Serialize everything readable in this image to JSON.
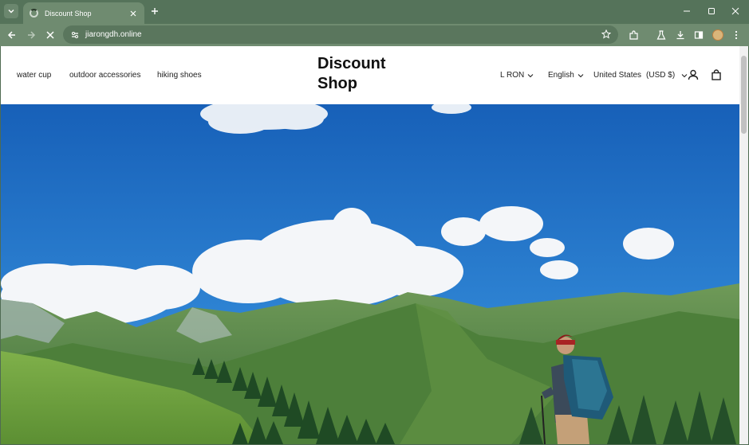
{
  "browser": {
    "tab_title": "Discount Shop",
    "url": "jiarongdh.online"
  },
  "store": {
    "logo_line1": "Discount",
    "logo_line2": "Shop",
    "nav": [
      "water cup",
      "outdoor accessories",
      "hiking shoes"
    ],
    "currency": "L RON",
    "language": "English",
    "country": "United States",
    "country_currency": "(USD $)"
  }
}
